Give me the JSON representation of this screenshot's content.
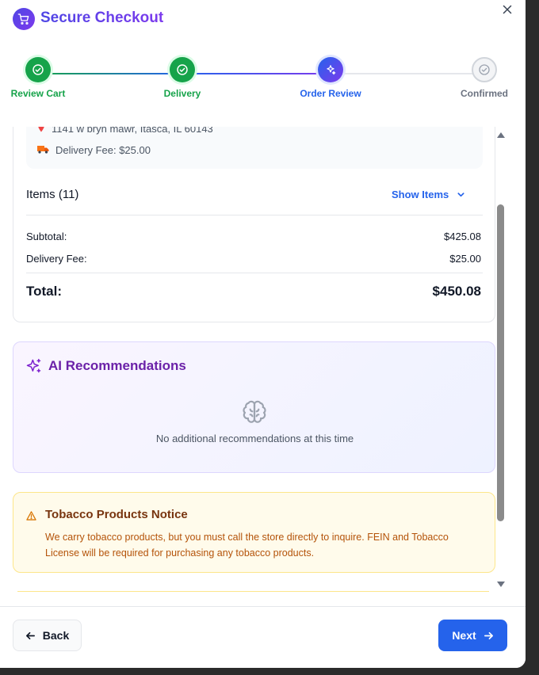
{
  "header": {
    "title": "Secure Checkout",
    "cart_icon": "shopping-cart-icon",
    "close_icon": "close-icon"
  },
  "stepper": {
    "steps": [
      {
        "label": "Review Cart",
        "state": "complete",
        "color": "#16a34a"
      },
      {
        "label": "Delivery",
        "state": "complete",
        "color": "#16a34a"
      },
      {
        "label": "Order Review",
        "state": "current",
        "color": "#2563eb"
      },
      {
        "label": "Confirmed",
        "state": "upcoming",
        "color": "#6b7280"
      }
    ]
  },
  "summary": {
    "address": "1141 w bryn mawr, Itasca, IL 60143",
    "delivery_fee_line": "Delivery Fee: $25.00",
    "items_label": "Items (11)",
    "show_items_label": "Show Items",
    "subtotal_label": "Subtotal:",
    "subtotal_value": "$425.08",
    "delivery_label": "Delivery Fee:",
    "delivery_value": "$25.00",
    "total_label": "Total:",
    "total_value": "$450.08"
  },
  "ai": {
    "title": "AI Recommendations",
    "empty_text": "No additional recommendations at this time"
  },
  "tobacco": {
    "title": "Tobacco Products Notice",
    "text": "We carry tobacco products, but you must call the store directly to inquire. FEIN and Tobacco License will be required for purchasing any tobacco products."
  },
  "footer": {
    "back_label": "Back",
    "next_label": "Next"
  },
  "colors": {
    "accent_blue": "#2563eb",
    "accent_purple": "#7c3aed",
    "success_green": "#16a34a",
    "warning_amber": "#b45309"
  }
}
